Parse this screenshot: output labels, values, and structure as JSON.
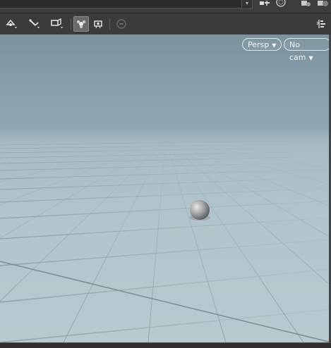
{
  "viewport": {
    "projection_label": "Persp",
    "camera_label": "No cam"
  },
  "icons": {
    "top": [
      "link-icon",
      "radar-icon",
      "shape-cube-icon",
      "shape-cube-plus-icon"
    ],
    "toolbar": [
      "select-transform-icon",
      "pose-tool-icon",
      "handle-tool-icon",
      "viewport-display-icon",
      "camera-view-icon",
      "stop-icon",
      "align-icon"
    ]
  },
  "colors": {
    "sky_top": "#7b939f",
    "horizon": "#a8bcc4",
    "ground": "#b8cad0",
    "grid_line": "#9fb0b7",
    "toolbar_bg": "#3b3b3b"
  }
}
